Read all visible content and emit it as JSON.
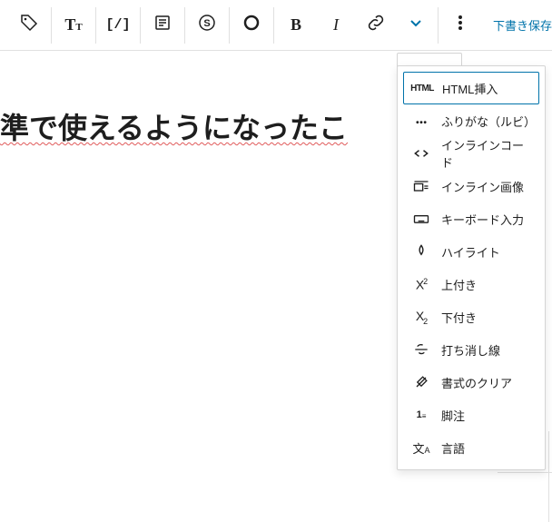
{
  "toolbar": {
    "save_label": "下書き保存"
  },
  "editor": {
    "heading_text": "準で使えるようになったこ"
  },
  "menu": {
    "items": [
      {
        "label": "HTML挿入",
        "icon": "html-icon",
        "selected": true
      },
      {
        "label": "ふりがな（ルビ）",
        "icon": "ruby-icon",
        "selected": false
      },
      {
        "label": "インラインコード",
        "icon": "code-icon",
        "selected": false
      },
      {
        "label": "インライン画像",
        "icon": "inline-image-icon",
        "selected": false
      },
      {
        "label": "キーボード入力",
        "icon": "keyboard-icon",
        "selected": false
      },
      {
        "label": "ハイライト",
        "icon": "highlight-icon",
        "selected": false
      },
      {
        "label": "上付き",
        "icon": "superscript-icon",
        "selected": false
      },
      {
        "label": "下付き",
        "icon": "subscript-icon",
        "selected": false
      },
      {
        "label": "打ち消し線",
        "icon": "strikethrough-icon",
        "selected": false
      },
      {
        "label": "書式のクリア",
        "icon": "clear-format-icon",
        "selected": false
      },
      {
        "label": "脚注",
        "icon": "footnote-icon",
        "selected": false
      },
      {
        "label": "言語",
        "icon": "language-icon",
        "selected": false
      }
    ]
  }
}
